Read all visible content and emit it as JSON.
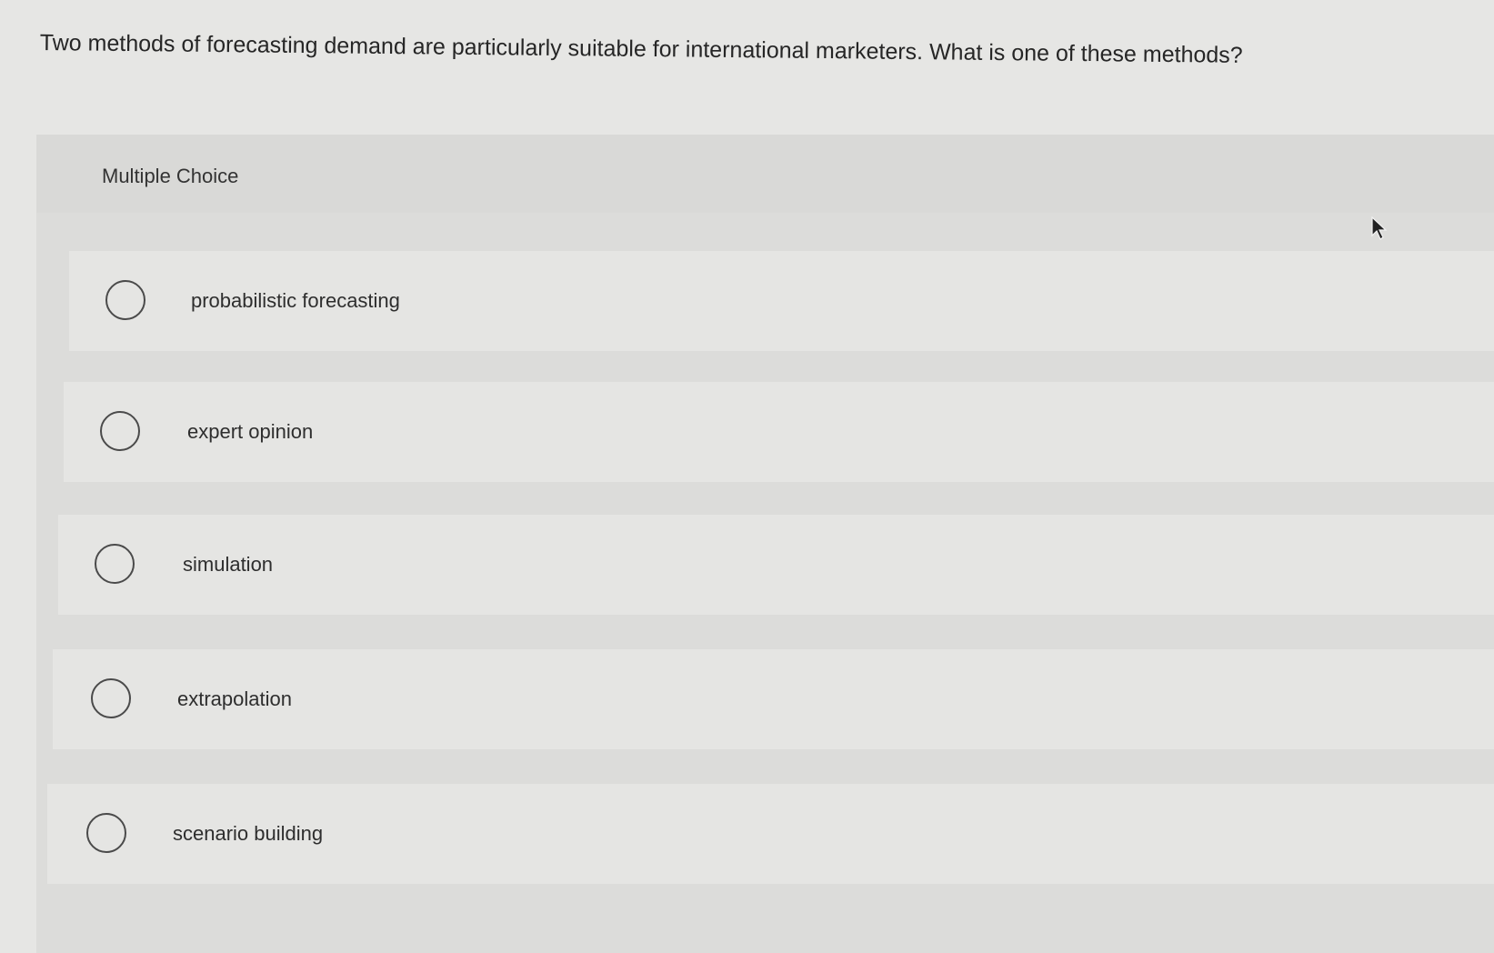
{
  "question": {
    "text": "Two methods of forecasting demand are particularly suitable for international marketers. What is one of these methods?"
  },
  "multiple_choice": {
    "label": "Multiple Choice",
    "options": [
      {
        "label": "probabilistic forecasting",
        "selected": false
      },
      {
        "label": "expert opinion",
        "selected": false
      },
      {
        "label": "simulation",
        "selected": false
      },
      {
        "label": "extrapolation",
        "selected": false
      },
      {
        "label": "scenario building",
        "selected": false
      }
    ]
  },
  "colors": {
    "page_background": "#e6e6e4",
    "panel_background": "#dcdcda",
    "option_background": "#e5e5e3",
    "radio_border": "#4a4a4a",
    "text": "#2b2b2b"
  },
  "icons": {
    "radio": "radio-button-icon",
    "cursor": "mouse-pointer-icon"
  }
}
